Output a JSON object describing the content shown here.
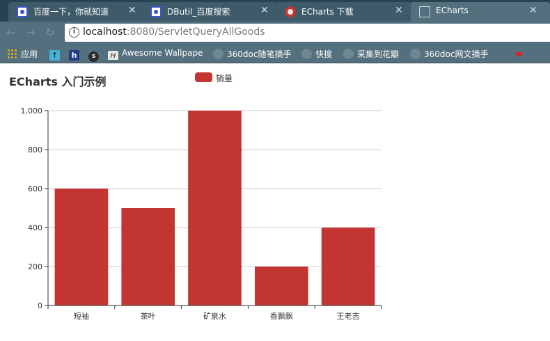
{
  "browser": {
    "tabs": [
      {
        "title": "百度一下，你就知道",
        "icon": "baidu-paw-icon",
        "active": false
      },
      {
        "title": "DButil_百度搜索",
        "icon": "baidu-paw-icon",
        "active": false
      },
      {
        "title": "ECharts 下载",
        "icon": "echarts-logo-icon",
        "active": false
      },
      {
        "title": "ECharts",
        "icon": "page-icon",
        "active": true
      }
    ],
    "close_glyph": "✕",
    "address": {
      "host": "localhost",
      "rest": ":8080/ServletQueryAllGoods"
    },
    "bookmarks": [
      {
        "label": "应用",
        "icon": "apps-grid-icon"
      },
      {
        "label": "",
        "icon": "arrow-up-icon"
      },
      {
        "label": "",
        "icon": "h-bookmark-icon"
      },
      {
        "label": "",
        "icon": "s-bookmark-icon"
      },
      {
        "label": "Awesome Wallpape",
        "icon": "h-italic-bookmark-icon"
      },
      {
        "label": "360doc随笔摘手",
        "icon": "globe-icon"
      },
      {
        "label": "快搜",
        "icon": "globe-icon"
      },
      {
        "label": "采集到花瓣",
        "icon": "globe-icon"
      },
      {
        "label": "360doc网文摘手",
        "icon": "globe-icon"
      },
      {
        "label": "",
        "icon": "heart-icon"
      }
    ]
  },
  "colors": {
    "bar": "#c23531",
    "axis": "#333333",
    "grid": "#cccccc"
  },
  "chart_data": {
    "type": "bar",
    "title": "ECharts 入门示例",
    "legend": [
      "销量"
    ],
    "legend_position": "top-center",
    "categories": [
      "短袖",
      "茶叶",
      "矿泉水",
      "香飘飘",
      "王老吉"
    ],
    "series": [
      {
        "name": "销量",
        "values": [
          600,
          500,
          1000,
          200,
          400
        ]
      }
    ],
    "ylim": [
      0,
      1000
    ],
    "yticks": [
      "0",
      "200",
      "400",
      "600",
      "800",
      "1,000"
    ],
    "grid": true
  }
}
